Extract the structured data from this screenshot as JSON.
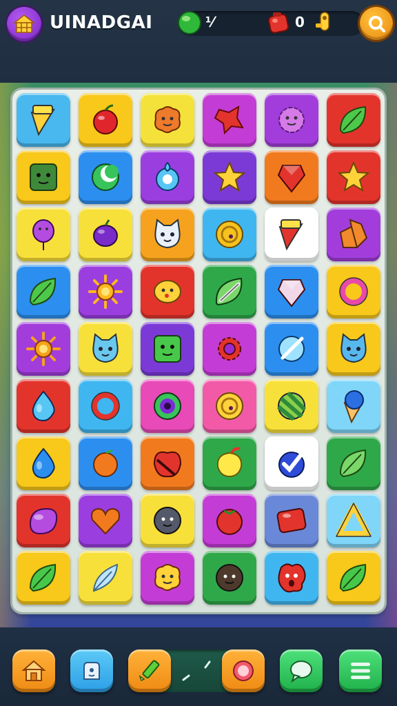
{
  "header": {
    "title": "UINADGAI",
    "green_count": "⅟",
    "red_count": "0"
  },
  "colors": {
    "board_frame": "#d8e2dc",
    "topbar": "#1f2f41"
  },
  "board": {
    "rows": 9,
    "cols": 6,
    "tiles": [
      [
        {
          "bg": "#48b8ef",
          "icon": "cone",
          "color": "#ffd23a"
        },
        {
          "bg": "#f8c81a",
          "icon": "cherry",
          "color": "#e0262c"
        },
        {
          "bg": "#f4e23a",
          "icon": "blob-face",
          "color": "#ee7a2c"
        },
        {
          "bg": "#c43cd6",
          "icon": "splat",
          "color": "#e2342c"
        },
        {
          "bg": "#a23ddc",
          "icon": "flower-face",
          "color": "#d67ae8"
        },
        {
          "bg": "#e3342c",
          "icon": "leaf",
          "color": "#4ec84a"
        }
      ],
      [
        {
          "bg": "#f8c81a",
          "icon": "block-face",
          "color": "#3f8a3a"
        },
        {
          "bg": "#2c8ff0",
          "icon": "moon",
          "color": "#38c45a"
        },
        {
          "bg": "#9b3ee0",
          "icon": "ring-drop",
          "color": "#58c6f4"
        },
        {
          "bg": "#7b3ad6",
          "icon": "star",
          "color": "#ffd23a"
        },
        {
          "bg": "#f27a1e",
          "icon": "gem",
          "color": "#e2342c"
        },
        {
          "bg": "#e3342c",
          "icon": "star",
          "color": "#ffd23a"
        }
      ],
      [
        {
          "bg": "#f8e03a",
          "icon": "balloon",
          "color": "#b54ce0"
        },
        {
          "bg": "#f8e03a",
          "icon": "grape",
          "color": "#7a2cc8"
        },
        {
          "bg": "#f6a21e",
          "icon": "cat-face",
          "color": "#e9f0f8"
        },
        {
          "bg": "#3fb6f0",
          "icon": "coin",
          "color": "#f6c21e"
        },
        {
          "bg": "#ffffff",
          "icon": "cone",
          "color": "#e2342c"
        },
        {
          "bg": "#a23ddc",
          "icon": "crystal",
          "color": "#f08a2c"
        }
      ],
      [
        {
          "bg": "#2c8ff0",
          "icon": "leaf",
          "color": "#4ec84a"
        },
        {
          "bg": "#9b3ee0",
          "icon": "sun",
          "color": "#ffb81e"
        },
        {
          "bg": "#e3342c",
          "icon": "lemon-face",
          "color": "#ffd23a"
        },
        {
          "bg": "#2fa84a",
          "icon": "leaf-chain",
          "color": "#7ad86a"
        },
        {
          "bg": "#2c8ff0",
          "icon": "gem",
          "color": "#f0d8e8"
        },
        {
          "bg": "#f8c81a",
          "icon": "ring",
          "color": "#e84aa8"
        }
      ],
      [
        {
          "bg": "#a23ddc",
          "icon": "sun",
          "color": "#f6a21e"
        },
        {
          "bg": "#f8e03a",
          "icon": "cat-face",
          "color": "#6ac8ee"
        },
        {
          "bg": "#7b3ad6",
          "icon": "block-face",
          "color": "#48c84a"
        },
        {
          "bg": "#c43cd6",
          "icon": "gear",
          "color": "#e2342c"
        },
        {
          "bg": "#2c8ff0",
          "icon": "orb-slash",
          "color": "#9ee2ff"
        },
        {
          "bg": "#f8c81a",
          "icon": "cat-face",
          "color": "#58b8ee"
        }
      ],
      [
        {
          "bg": "#e3342c",
          "icon": "drop",
          "color": "#58c6f4"
        },
        {
          "bg": "#3fb6f0",
          "icon": "ring",
          "color": "#e2342c"
        },
        {
          "bg": "#e84ab8",
          "icon": "eye-ring",
          "color": "#38c45a"
        },
        {
          "bg": "#f25aa8",
          "icon": "coin",
          "color": "#ffd23a"
        },
        {
          "bg": "#f8e03a",
          "icon": "striped-ball",
          "color": "#2f8a3a"
        },
        {
          "bg": "#7fd6f8",
          "icon": "ice-cream",
          "color": "#2c6fe0"
        }
      ],
      [
        {
          "bg": "#f8c81a",
          "icon": "drop",
          "color": "#2c8ff0"
        },
        {
          "bg": "#2c8ff0",
          "icon": "orange",
          "color": "#f27a1e"
        },
        {
          "bg": "#f27a1e",
          "icon": "apple-slash",
          "color": "#e2342c"
        },
        {
          "bg": "#2fa84a",
          "icon": "lemon",
          "color": "#ffe94a"
        },
        {
          "bg": "#ffffff",
          "icon": "check",
          "color": "#2f4cd8"
        },
        {
          "bg": "#2fa84a",
          "icon": "leaf",
          "color": "#7ad86a"
        }
      ],
      [
        {
          "bg": "#e3342c",
          "icon": "jelly",
          "color": "#b54ce0"
        },
        {
          "bg": "#9b3ee0",
          "icon": "heart",
          "color": "#f27a1e"
        },
        {
          "bg": "#f8e03a",
          "icon": "ball-face",
          "color": "#555a6a"
        },
        {
          "bg": "#c43cd6",
          "icon": "tomato",
          "color": "#e2342c"
        },
        {
          "bg": "#6a88d8",
          "icon": "gem-block",
          "color": "#e2342c"
        },
        {
          "bg": "#7fd6f8",
          "icon": "triangle",
          "color": "#ffd23a"
        }
      ],
      [
        {
          "bg": "#f8c81a",
          "icon": "leaf",
          "color": "#48c84a"
        },
        {
          "bg": "#f8e03a",
          "icon": "feather",
          "color": "#bfe4fa"
        },
        {
          "bg": "#c43cd6",
          "icon": "blob-face",
          "color": "#ffd23a"
        },
        {
          "bg": "#2fa84a",
          "icon": "ball-face",
          "color": "#4e3a2c"
        },
        {
          "bg": "#3fb6f0",
          "icon": "splat-face",
          "color": "#e2342c"
        },
        {
          "bg": "#f8c81a",
          "icon": "leaf",
          "color": "#48c84a"
        }
      ]
    ]
  },
  "bottom_bar": {
    "buttons": [
      {
        "name": "home-button",
        "icon": "home-icon",
        "bg": "#f6a21e"
      },
      {
        "name": "inventory-button",
        "icon": "bag-icon",
        "bg": "#3fb6f0"
      },
      {
        "name": "pencil-button",
        "icon": "pencil-icon",
        "bg": "#f6a21e"
      },
      {
        "name": "target-button",
        "icon": "target-icon",
        "bg": "#f6a21e"
      },
      {
        "name": "chat-button",
        "icon": "chat-icon",
        "bg": "#2fc85a"
      },
      {
        "name": "menu-button",
        "icon": "menu-icon",
        "bg": "#2fc85a"
      }
    ]
  }
}
